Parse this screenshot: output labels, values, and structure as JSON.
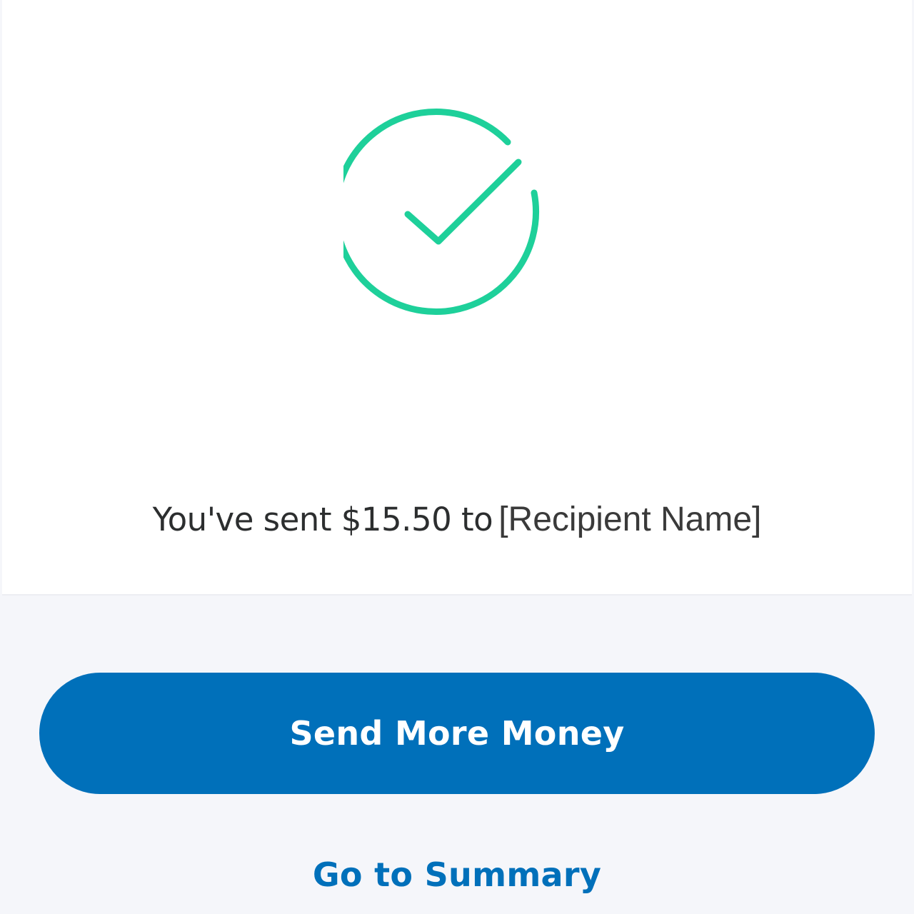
{
  "confirmation": {
    "icon": "check-circle-icon",
    "icon_color": "#1ed09a",
    "message_prefix": "You've sent $15.50 to",
    "recipient": "[Recipient Name]"
  },
  "actions": {
    "send_more_label": "Send More Money",
    "summary_label": "Go to Summary",
    "accent_color": "#0070ba"
  }
}
